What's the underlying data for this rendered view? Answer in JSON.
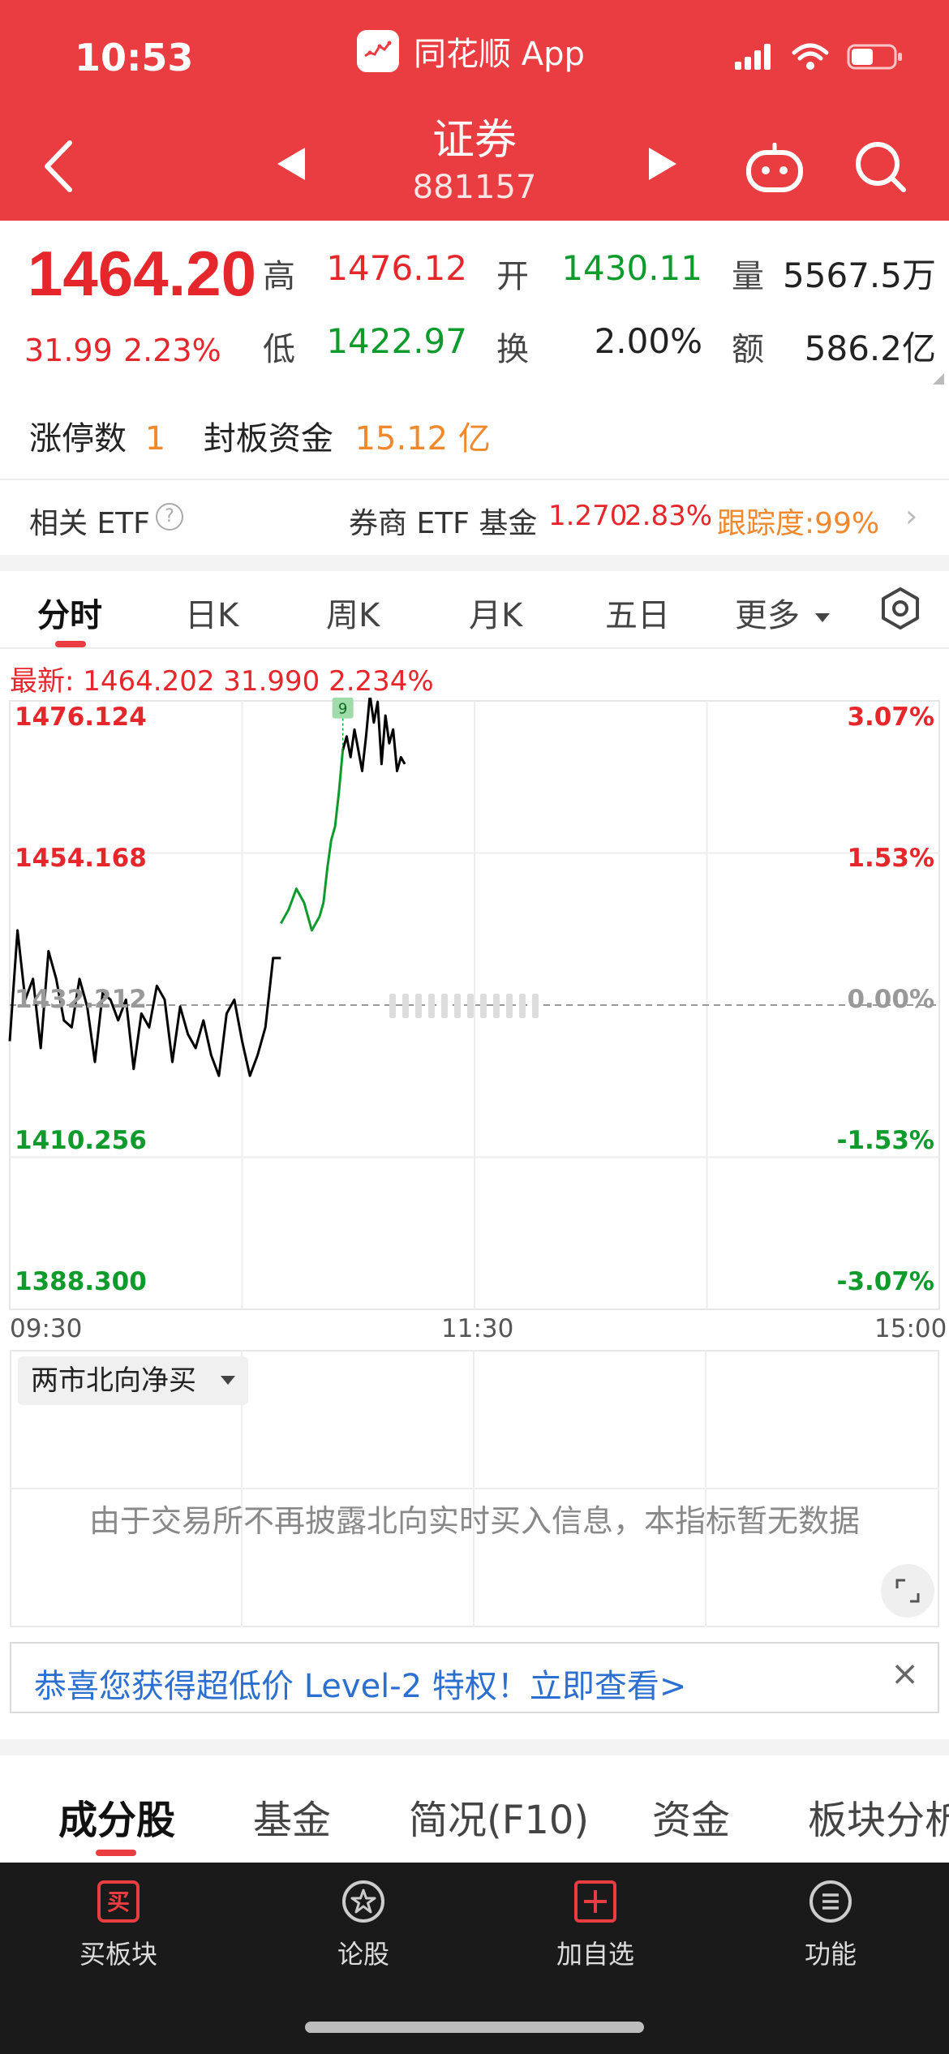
{
  "status_bar": {
    "time": "10:53"
  },
  "app": {
    "name": "同花顺 App"
  },
  "header": {
    "title": "证券",
    "code": "881157"
  },
  "quote": {
    "price": "1464.20",
    "change": "31.99",
    "change_pct": "2.23%",
    "high_label": "高",
    "high": "1476.12",
    "open_label": "开",
    "open": "1430.11",
    "volume_label": "量",
    "volume": "5567.5万",
    "low_label": "低",
    "low": "1422.97",
    "turnover_label": "换",
    "turnover": "2.00%",
    "amount_label": "额",
    "amount": "586.2亿",
    "limit_up_label": "涨停数",
    "limit_up": "1",
    "seal_label": "封板资金",
    "seal_amount": "15.12 亿"
  },
  "etf": {
    "label": "相关 ETF",
    "name": "券商 ETF 基金",
    "price": "1.270",
    "pct": "2.83%",
    "tracking": "跟踪度:99%"
  },
  "chart_tabs": [
    "分时",
    "日K",
    "周K",
    "月K",
    "五日",
    "更多"
  ],
  "chart_info": {
    "latest": "最新: 1464.202  31.990  2.234%"
  },
  "chart_data": {
    "type": "line",
    "xlabel": "",
    "ylabel": "",
    "x_ticks": [
      "09:30",
      "11:30",
      "15:00"
    ],
    "y_ticks_left": [
      "1476.124",
      "1454.168",
      "1432.212",
      "1410.256",
      "1388.300"
    ],
    "y_ticks_right": [
      "3.07%",
      "1.53%",
      "0.00%",
      "-1.53%",
      "-3.07%"
    ],
    "ylim": [
      1388.3,
      1476.124
    ],
    "prev_close": 1432.212,
    "marker": "9",
    "series": [
      {
        "color": "#000000",
        "x": [
          0,
          2,
          4,
          6,
          8,
          10,
          12,
          14,
          16,
          18,
          20,
          22,
          24,
          26,
          28,
          30,
          32,
          34,
          36,
          38,
          40,
          42,
          44,
          46,
          48,
          50,
          52,
          54,
          56,
          58,
          60,
          62,
          64,
          66,
          68,
          70
        ],
        "values": [
          1427,
          1443,
          1433,
          1436,
          1426,
          1440,
          1436,
          1430,
          1429,
          1436,
          1432,
          1424,
          1434,
          1433,
          1430,
          1433,
          1423,
          1431,
          1429,
          1435,
          1433,
          1424,
          1432,
          1428,
          1426,
          1430,
          1425,
          1422,
          1431,
          1433,
          1427,
          1422,
          1425,
          1429,
          1439,
          1439
        ]
      },
      {
        "color": "#0f9b2c",
        "x": [
          70,
          72,
          74,
          76,
          78,
          80
        ],
        "values": [
          1444,
          1446,
          1449,
          1447,
          1443,
          1445
        ]
      },
      {
        "color": "#0f9b2c",
        "x": [
          80,
          81,
          82,
          83,
          84,
          85,
          86
        ],
        "values": [
          1445,
          1447,
          1452,
          1456,
          1458,
          1463,
          1469
        ]
      },
      {
        "color": "#000000",
        "x": [
          86,
          87,
          88,
          89,
          90,
          91,
          92,
          93,
          94,
          95,
          96,
          97,
          98,
          99,
          100,
          101,
          102
        ],
        "values": [
          1469,
          1471,
          1468,
          1472,
          1469,
          1466,
          1471,
          1477,
          1473,
          1476,
          1467,
          1474,
          1470,
          1472,
          1466,
          1468,
          1467
        ]
      }
    ],
    "total_points": 240
  },
  "indicator": {
    "select_label": "两市北向净买",
    "message": "由于交易所不再披露北向实时买入信息，本指标暂无数据"
  },
  "promo": {
    "text": "恭喜您获得超低价 Level-2 特权！立即查看>"
  },
  "sub_tabs": [
    "成分股",
    "基金",
    "简况(F10)",
    "资金",
    "板块分析"
  ],
  "bottom_nav": [
    {
      "label": "买板块",
      "icon": "buy-icon"
    },
    {
      "label": "论股",
      "icon": "discuss-icon"
    },
    {
      "label": "加自选",
      "icon": "add-watchlist-icon"
    },
    {
      "label": "功能",
      "icon": "menu-icon"
    }
  ],
  "colors": {
    "header": "#ea3d41",
    "up": "#e5262b",
    "down": "#0f9b2c",
    "accent_orange": "#f0892e",
    "link_blue": "#2b6fd1"
  }
}
